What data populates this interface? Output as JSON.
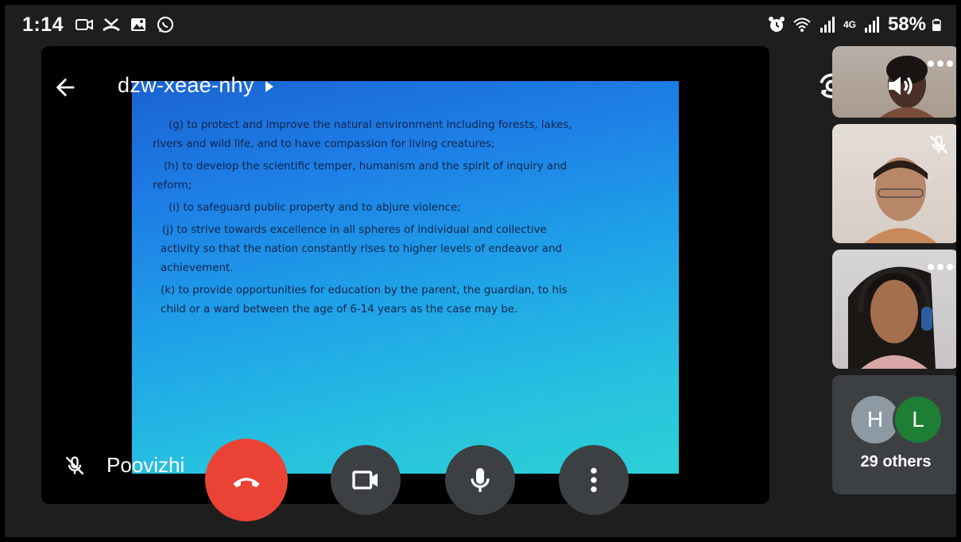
{
  "status_bar": {
    "time": "1:14",
    "battery_percent": "58%",
    "network": "4G",
    "left_icons": [
      "video-record-icon",
      "missed-call-icon",
      "gallery-icon",
      "whatsapp-icon"
    ],
    "right_icons": [
      "alarm-icon",
      "wifi-icon",
      "signal-icon",
      "signal-4g-icon",
      "battery-icon"
    ]
  },
  "meeting": {
    "code": "dzw-xeae-nhy"
  },
  "slide": {
    "lines": [
      "(g) to protect and improve the natural environment including forests, lakes,",
      "rivers and wild life, and to have compassion for living creatures;",
      "(h) to develop the scientific temper, humanism and the spirit of inquiry and",
      "reform;",
      "(i) to safeguard public property and to abjure violence;",
      "(j) to strive towards excellence in all spheres of individual and collective",
      "activity so that the nation constantly rises to higher levels of endeavor and",
      "achievement.",
      "(k) to provide opportunities for education by the parent, the guardian, to his",
      "child or a ward between the age of 6-14 years as the case may be."
    ]
  },
  "presenter": {
    "name": "Poovizhi"
  },
  "participants": {
    "others_avatars": [
      "H",
      "L"
    ],
    "others_label": "29 others"
  },
  "colors": {
    "end_call": "#ea4335",
    "control_bg": "#3c4043",
    "avatar_h": "#8e9aa3",
    "avatar_l": "#1e7e34"
  }
}
